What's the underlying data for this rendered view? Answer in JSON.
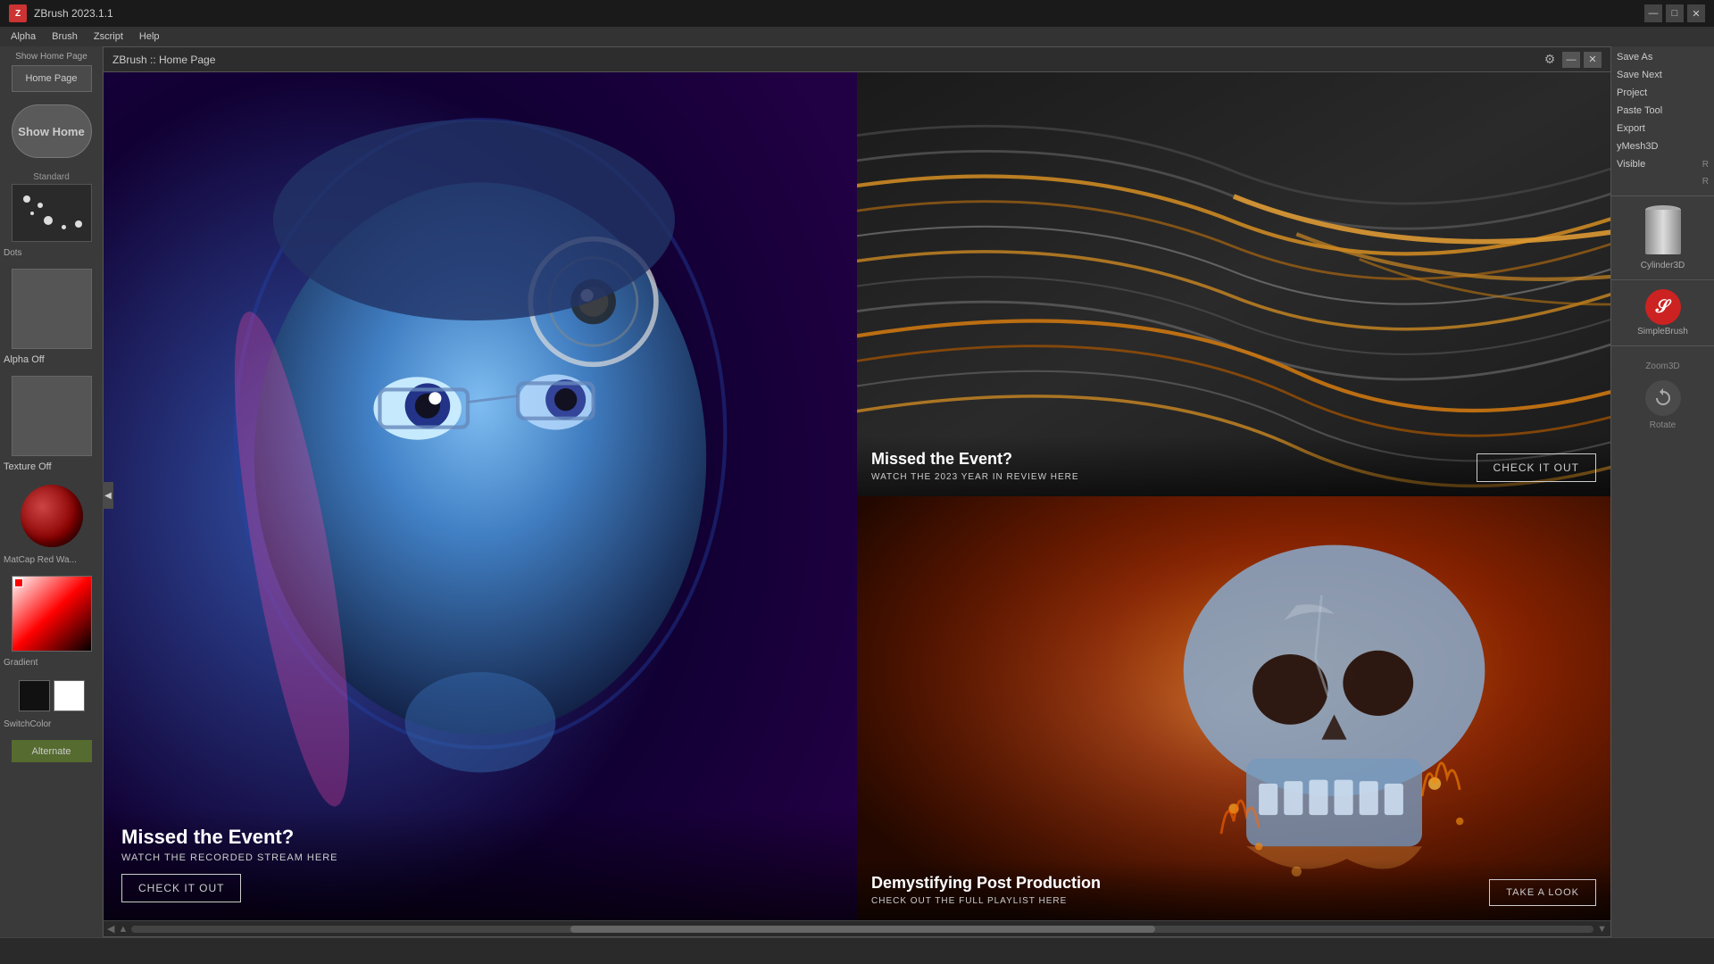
{
  "app": {
    "title": "ZBrush 2023.1.1",
    "dialog_title": "ZBrush :: Home Page"
  },
  "menu_bar": {
    "items": [
      "Alpha",
      "Brush",
      "Zscript",
      "Help"
    ]
  },
  "left_sidebar": {
    "show_home_page_label": "Show Home Page",
    "home_page_btn": "Home Page",
    "show_home_btn": "Show Home",
    "standard_label": "Standard",
    "dots_label": "Dots",
    "alpha_label": "Alpha Off",
    "texture_label": "Texture Off",
    "matcap_label": "MatCap Red Wa...",
    "gradient_label": "Gradient",
    "switch_color_label": "SwitchColor",
    "alternate_btn": "Alternate"
  },
  "title_bar_controls": {
    "minimize": "—",
    "maximize": "□",
    "close": "✕"
  },
  "dialog_controls": {
    "gear": "⚙",
    "minimize": "—",
    "close": "✕"
  },
  "panel_main": {
    "title": "Missed the Event?",
    "subtitle": "WATCH THE RECORDED STREAM HERE",
    "btn_label": "CHECK IT OUT"
  },
  "panel_waves": {
    "title": "Missed the Event?",
    "subtitle": "WATCH THE 2023 YEAR IN REVIEW HERE",
    "btn_label": "CHECK IT OUT"
  },
  "panel_skull": {
    "title": "Demystifying Post Production",
    "subtitle": "CHECK OUT THE FULL PLAYLIST HERE",
    "btn_label": "TAKE A LOOK"
  },
  "right_sidebar": {
    "items": [
      {
        "label": "Save As",
        "shortcut": ""
      },
      {
        "label": "Save Next",
        "shortcut": ""
      },
      {
        "label": "Project",
        "shortcut": ""
      },
      {
        "label": "Paste Tool",
        "shortcut": ""
      },
      {
        "label": "Export",
        "shortcut": ""
      },
      {
        "label": "yMesh3D",
        "shortcut": ""
      },
      {
        "label": "Visible",
        "shortcut": "R"
      }
    ],
    "shortcut_r": "R",
    "cylinder_label": "Cylinder3D",
    "simple_brush_label": "SimpleBrush",
    "zoom3d_label": "Zoom3D",
    "rotate_label": "Rotate"
  },
  "bottom_bar": {
    "left_text": "",
    "center_text": "",
    "right_text": ""
  }
}
